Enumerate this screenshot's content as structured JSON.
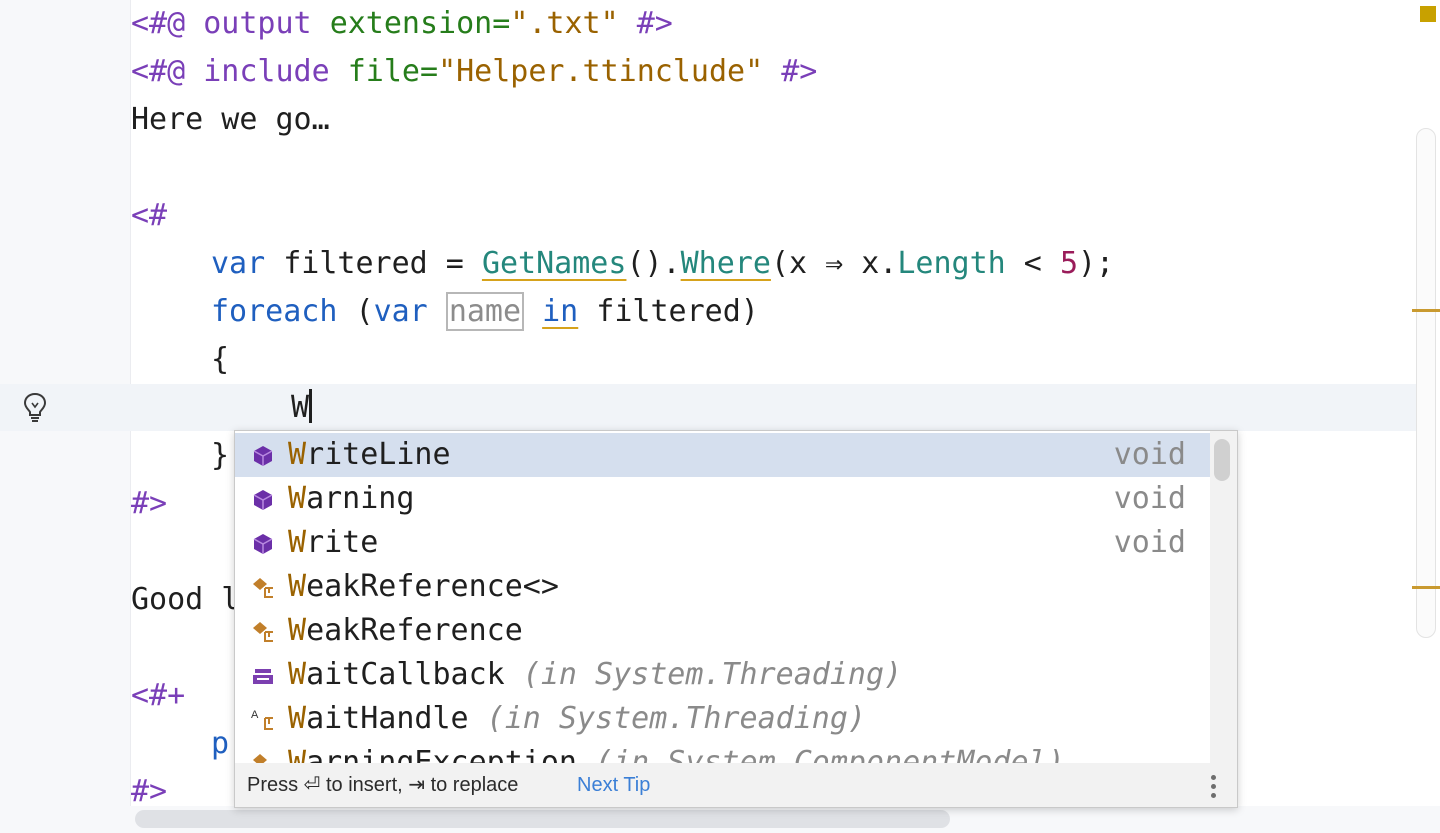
{
  "editor": {
    "lines": {
      "l1": {
        "open": "<#@",
        "name": "output",
        "attr": "extension=",
        "value": "\".txt\"",
        "close": "#>"
      },
      "l2": {
        "open": "<#@",
        "name": "include",
        "attr": "file=",
        "value": "\"Helper.ttinclude\"",
        "close": "#>"
      },
      "l3": {
        "text": "Here we go…"
      },
      "l5": {
        "text": "<#"
      },
      "l6": {
        "kw": "var",
        "t1": " filtered = ",
        "m1": "GetNames",
        "t2": "().",
        "m2": "Where",
        "t3": "(x ⇒ x.",
        "m3": "Length",
        "t4": " < ",
        "num": "5",
        "t5": ");"
      },
      "l7": {
        "kw": "foreach",
        "t1": " (",
        "kw2": "var",
        "hint": "name",
        "kw3": "in",
        "t2": " filtered)"
      },
      "l8": {
        "text": "{"
      },
      "l9": {
        "text": "W"
      },
      "l10": {
        "text": "}"
      },
      "l11": {
        "text": "#>"
      },
      "l13": {
        "text": "Good l"
      },
      "l15": {
        "text": "<#+"
      },
      "l16": {
        "text": "pr"
      },
      "l18": {
        "text": "#>"
      }
    }
  },
  "completion": {
    "items": [
      {
        "match": "W",
        "rest": "riteLine",
        "suffix": "",
        "type": "void",
        "icon": "method-icon"
      },
      {
        "match": "W",
        "rest": "arning",
        "suffix": "",
        "type": "void",
        "icon": "method-icon"
      },
      {
        "match": "W",
        "rest": "rite",
        "suffix": "",
        "type": "void",
        "icon": "method-icon"
      },
      {
        "match": "W",
        "rest": "eakReference<>",
        "suffix": "",
        "type": "",
        "icon": "class-icon"
      },
      {
        "match": "W",
        "rest": "eakReference",
        "suffix": "",
        "type": "",
        "icon": "class-icon"
      },
      {
        "match": "W",
        "rest": "aitCallback",
        "suffix": " (in System.Threading)",
        "type": "",
        "icon": "delegate-icon"
      },
      {
        "match": "W",
        "rest": "aitHandle",
        "suffix": " (in System.Threading)",
        "type": "",
        "icon": "abstract-class-icon"
      },
      {
        "match": "W",
        "rest": "arningException",
        "suffix": " (in System.ComponentModel)",
        "type": "",
        "icon": "class-icon"
      }
    ],
    "footer": {
      "text": "Press ⏎ to insert, ⇥ to replace",
      "tip": "Next Tip"
    }
  },
  "colors": {
    "accent": "#3b7fd6",
    "selection": "#d5dfee",
    "directive": "#7a3fb8",
    "keyword": "#1f5fbf"
  }
}
